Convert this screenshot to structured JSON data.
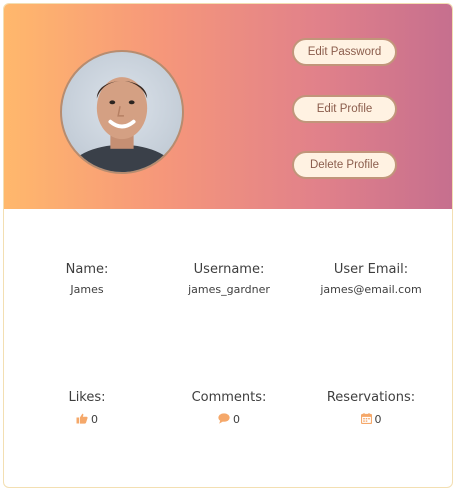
{
  "profile": {
    "avatar_alt": "Profile photo",
    "actions": {
      "edit_password": "Edit Password",
      "edit_profile": "Edit Profile",
      "delete_profile": "Delete Profile"
    },
    "info": {
      "name_label": "Name:",
      "name_value": "James",
      "username_label": "Username:",
      "username_value": "james_gardner",
      "email_label": "User Email:",
      "email_value": "james@email.com"
    },
    "stats": {
      "likes_label": "Likes:",
      "likes_value": "0",
      "comments_label": "Comments:",
      "comments_value": "0",
      "reservations_label": "Reservations:",
      "reservations_value": "0"
    }
  },
  "colors": {
    "gradient_start": "#ffb86c",
    "gradient_end": "#c66f8e",
    "icon_accent": "#f5a86a",
    "button_bg": "#fff2e2",
    "button_border": "#c1957a"
  },
  "icons": {
    "likes": "thumbs-up-icon",
    "comments": "comment-icon",
    "reservations": "calendar-icon"
  }
}
